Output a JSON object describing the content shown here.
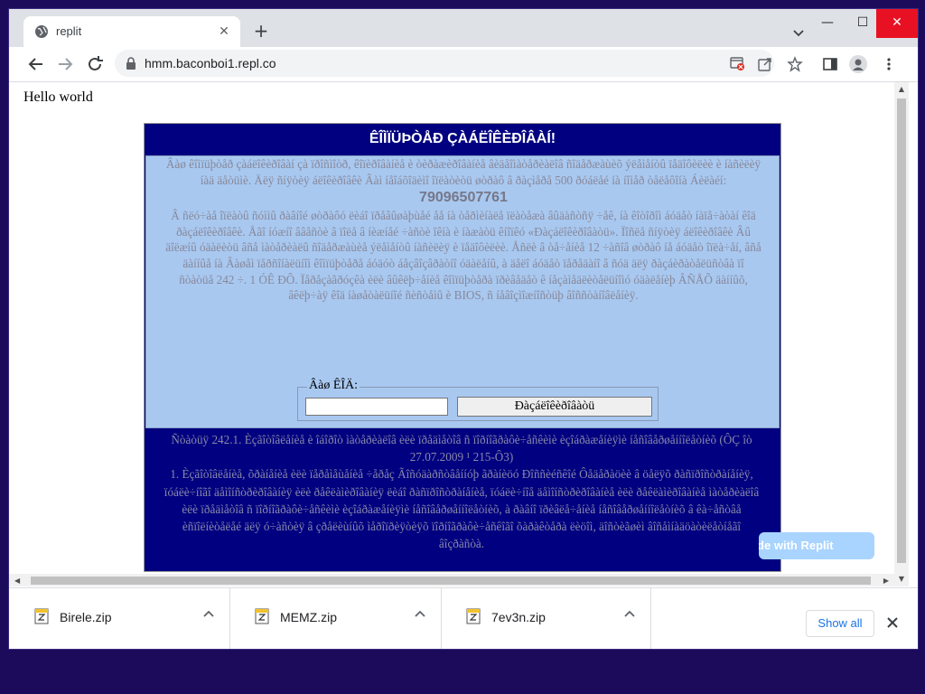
{
  "browser": {
    "tab_title": "replit",
    "tab_close": "✕",
    "new_tab": "+",
    "url": "hmm.baconboi1.repl.co",
    "window_controls": {
      "minimize": "—",
      "maximize": "☐",
      "close": "✕"
    }
  },
  "page": {
    "hello": "Hello world",
    "panel_title": "ÊÎÌÏÜÞÒÅÐ ÇÀÁËÎÊÈÐÎÂÀÍ!",
    "body_text_1": "Âàø êîìïüþòåð çàáëîêèðîâàí çà ïðîñìîòð, êîïèðîâàíèå è òèðàæèðîâàíèå âèäåîìàòåðèàëîâ ñîäåðæàùèõ ýëåìåíòû ïåäîôèëèè è íàñèëèÿ íàä äåòüìè. Äëÿ ñíÿòèÿ áëîêèðîâêè Âàì íåîáõîäèìî îïëàòèòü øòðàô â ðàçìåðå 500 ðóáëåé íà íîìåð òåëåôîíà Áèëàéí:",
    "phone": "79096507761",
    "body_text_2": "Â ñëó÷àå îïëàòû ñóììû ðàâíîé øòðàôó ëèáî ïðåâûøàþùåé åå íà òåðìèíàëå ïëàòåæà âûäàñòñÿ ÷åê, íà êîòîðîì áóäåò íàïå÷àòàí êîä ðàçáëîêèðîâêè. Åãî íóæíî ââåñòè â ïîëå â íèæíåé ÷àñòè îêíà è íàæàòü êíîïêó «Ðàçáëîêèðîâàòü». Ïîñëå ñíÿòèÿ áëîêèðîâêè Âû äîëæíû óäàëèòü âñå ìàòåðèàëû ñîäåðæàùèå ýëåìåíòû íàñèëèÿ è ïåäîôèëèè. Åñëè â òå÷åíèå 12 ÷àñîâ øòðàô íå áóäåò îïëà÷åí, âñå äàííûå íà Âàøåì ïåðñîíàëüíîì êîìïüþòåðå áóäóò áåçâîçâðàòíî óäàëåíû, à äåëî áóäåò ïåðåäàíî â ñóä äëÿ ðàçáèðàòåëüñòâà ïî ñòàòüå 242 ÷. 1 ÓÊ ÐÔ. Ïåðåçàãðóçêà èëè âûêëþ÷åíèå êîìïüþòåðà ïðèâåäåò ê íåçàìåäëèòåëüíîìó óäàëåíèþ ÂÑÅÕ äàííûõ, âêëþ÷àÿ êîä íàøåòàëüíîé ñèñòåìû è BIOS, ñ íåâîçìîæíîñòüþ âîññòàíîâëåíèÿ.",
    "code_legend": "Âàø ÊÎÄ:",
    "code_value": "",
    "code_button": "Ðàçáëîêèðîâàòü",
    "law_title": "Ñòàòüÿ 242.1. Èçãîòîâëåíèå è îáîðîò ìàòåðèàëîâ èëè ïðåäìåòîâ ñ ïîðíîãðàôè÷åñêèìè èçîáðàæåíèÿìè íåñîâåðøåííîëåòíèõ (ÔÇ îò 27.07.2009 ¹ 215-Ô3)",
    "law_text": "1. Èçãîòîâëåíèå, õðàíåíèå èëè ïåðåìåùåíèå ÷åðåç Ãîñóäàðñòâåííóþ ãðàíèöó Ðîññèéñêîé Ôåäåðàöèè â öåëÿõ ðàñïðîñòðàíåíèÿ, ïóáëè÷íîãî äåìîíñòðèðîâàíèÿ èëè ðåêëàìèðîâàíèÿ ëèáî ðàñïðîñòðàíåíèå, ïóáëè÷íîå äåìîíñòðèðîâàíèå èëè ðåêëàìèðîâàíèå ìàòåðèàëîâ èëè ïðåäìåòîâ ñ ïîðíîãðàôè÷åñêèìè èçîáðàæåíèÿìè íåñîâåðøåííîëåòíèõ, à ðàâíî ïðèâëå÷åíèå íåñîâåðøåííîëåòíèõ â êà÷åñòâå èñïîëíèòåëåé äëÿ ó÷àñòèÿ â çðåëèùíûõ ìåðîïðèÿòèÿõ ïîðíîãðàôè÷åñêîãî õàðàêòåðà ëèöîì, äîñòèãøèì âîñåìíàäöàòèëåòíåãî âîçðàñòà.",
    "replit_badge": "Made with Replit"
  },
  "downloads": {
    "items": [
      {
        "name": "Birele.zip"
      },
      {
        "name": "MEMZ.zip"
      },
      {
        "name": "7ev3n.zip"
      }
    ],
    "show_all": "Show all"
  },
  "colors": {
    "desktop": "#1c0a5a",
    "panel_navy": "#000080",
    "panel_light": "#a8c8f0",
    "chrome_gray": "#dee1e6",
    "link_blue": "#1a73e8"
  },
  "icons": [
    "globe-icon",
    "close-icon",
    "plus-icon",
    "chevron-down-icon",
    "minimize-icon",
    "maximize-icon",
    "back-arrow-icon",
    "forward-arrow-icon",
    "reload-icon",
    "lock-icon",
    "blocked-popup-icon",
    "share-icon",
    "star-icon",
    "side-panel-icon",
    "profile-icon",
    "kebab-menu-icon",
    "zip-file-icon",
    "chevron-up-icon"
  ]
}
